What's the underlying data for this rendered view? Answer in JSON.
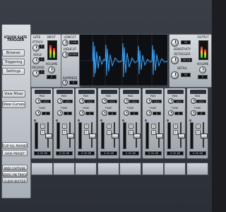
{
  "brand": {
    "line1": "STEVEN SLATE",
    "line2": "TRIGGER"
  },
  "nav": {
    "browser": "Browser",
    "triggering": "Triggering",
    "settings": "Settings",
    "view_mixer": "View Mixer",
    "view_curves": "View Curves",
    "flip_all_phases": "FLIP ALL PHASES",
    "save_preset": "SAVE PRESET",
    "midi_capture": "MIDI CAPTURE",
    "drag_on_track": "DRAG ON TRACK",
    "clear_buffer": "CLEAR BUFFER"
  },
  "input_section": {
    "gate_label": "GATE",
    "input_label": "INPUT",
    "attack_label": "ATTACK",
    "hold_label": "HOLD",
    "release_label": "RELEASE",
    "volume_label": "VOLUME",
    "attack_value": "0",
    "hold_value": "0",
    "release_value": "0",
    "volume_value": "0"
  },
  "filter_section": {
    "lowcut_label": "LOWCUT",
    "lowcut_value": "0 Hz",
    "highcut_label": "HIGHCUT",
    "highcut_value": "20000 Hz",
    "suppress_label": "SUPPRESS",
    "suppress_value": "0"
  },
  "output_section": {
    "output_label": "OUTPUT",
    "sensitivity_label": "SENSITIVITY",
    "sensitivity_value": "25",
    "retrigger_label": "RETRIGGER",
    "retrigger_value": "30 ms",
    "detail_label": "DETAIL",
    "detail_value": "20",
    "volume_label": "VOLUME",
    "volume_value": "0"
  },
  "channel": {
    "pan_label": "PAN",
    "pan_value": "<C>",
    "tune_label": "TUNE",
    "tune_value": "0",
    "m_label": "M",
    "s_label": "S",
    "db_value": "0.00 dB"
  },
  "colors": {
    "waveform": "#3aa6ff",
    "accent_blue": "#2f7fd0"
  },
  "icons": {
    "knob": "knob-icon",
    "waveform": "waveform-display"
  }
}
